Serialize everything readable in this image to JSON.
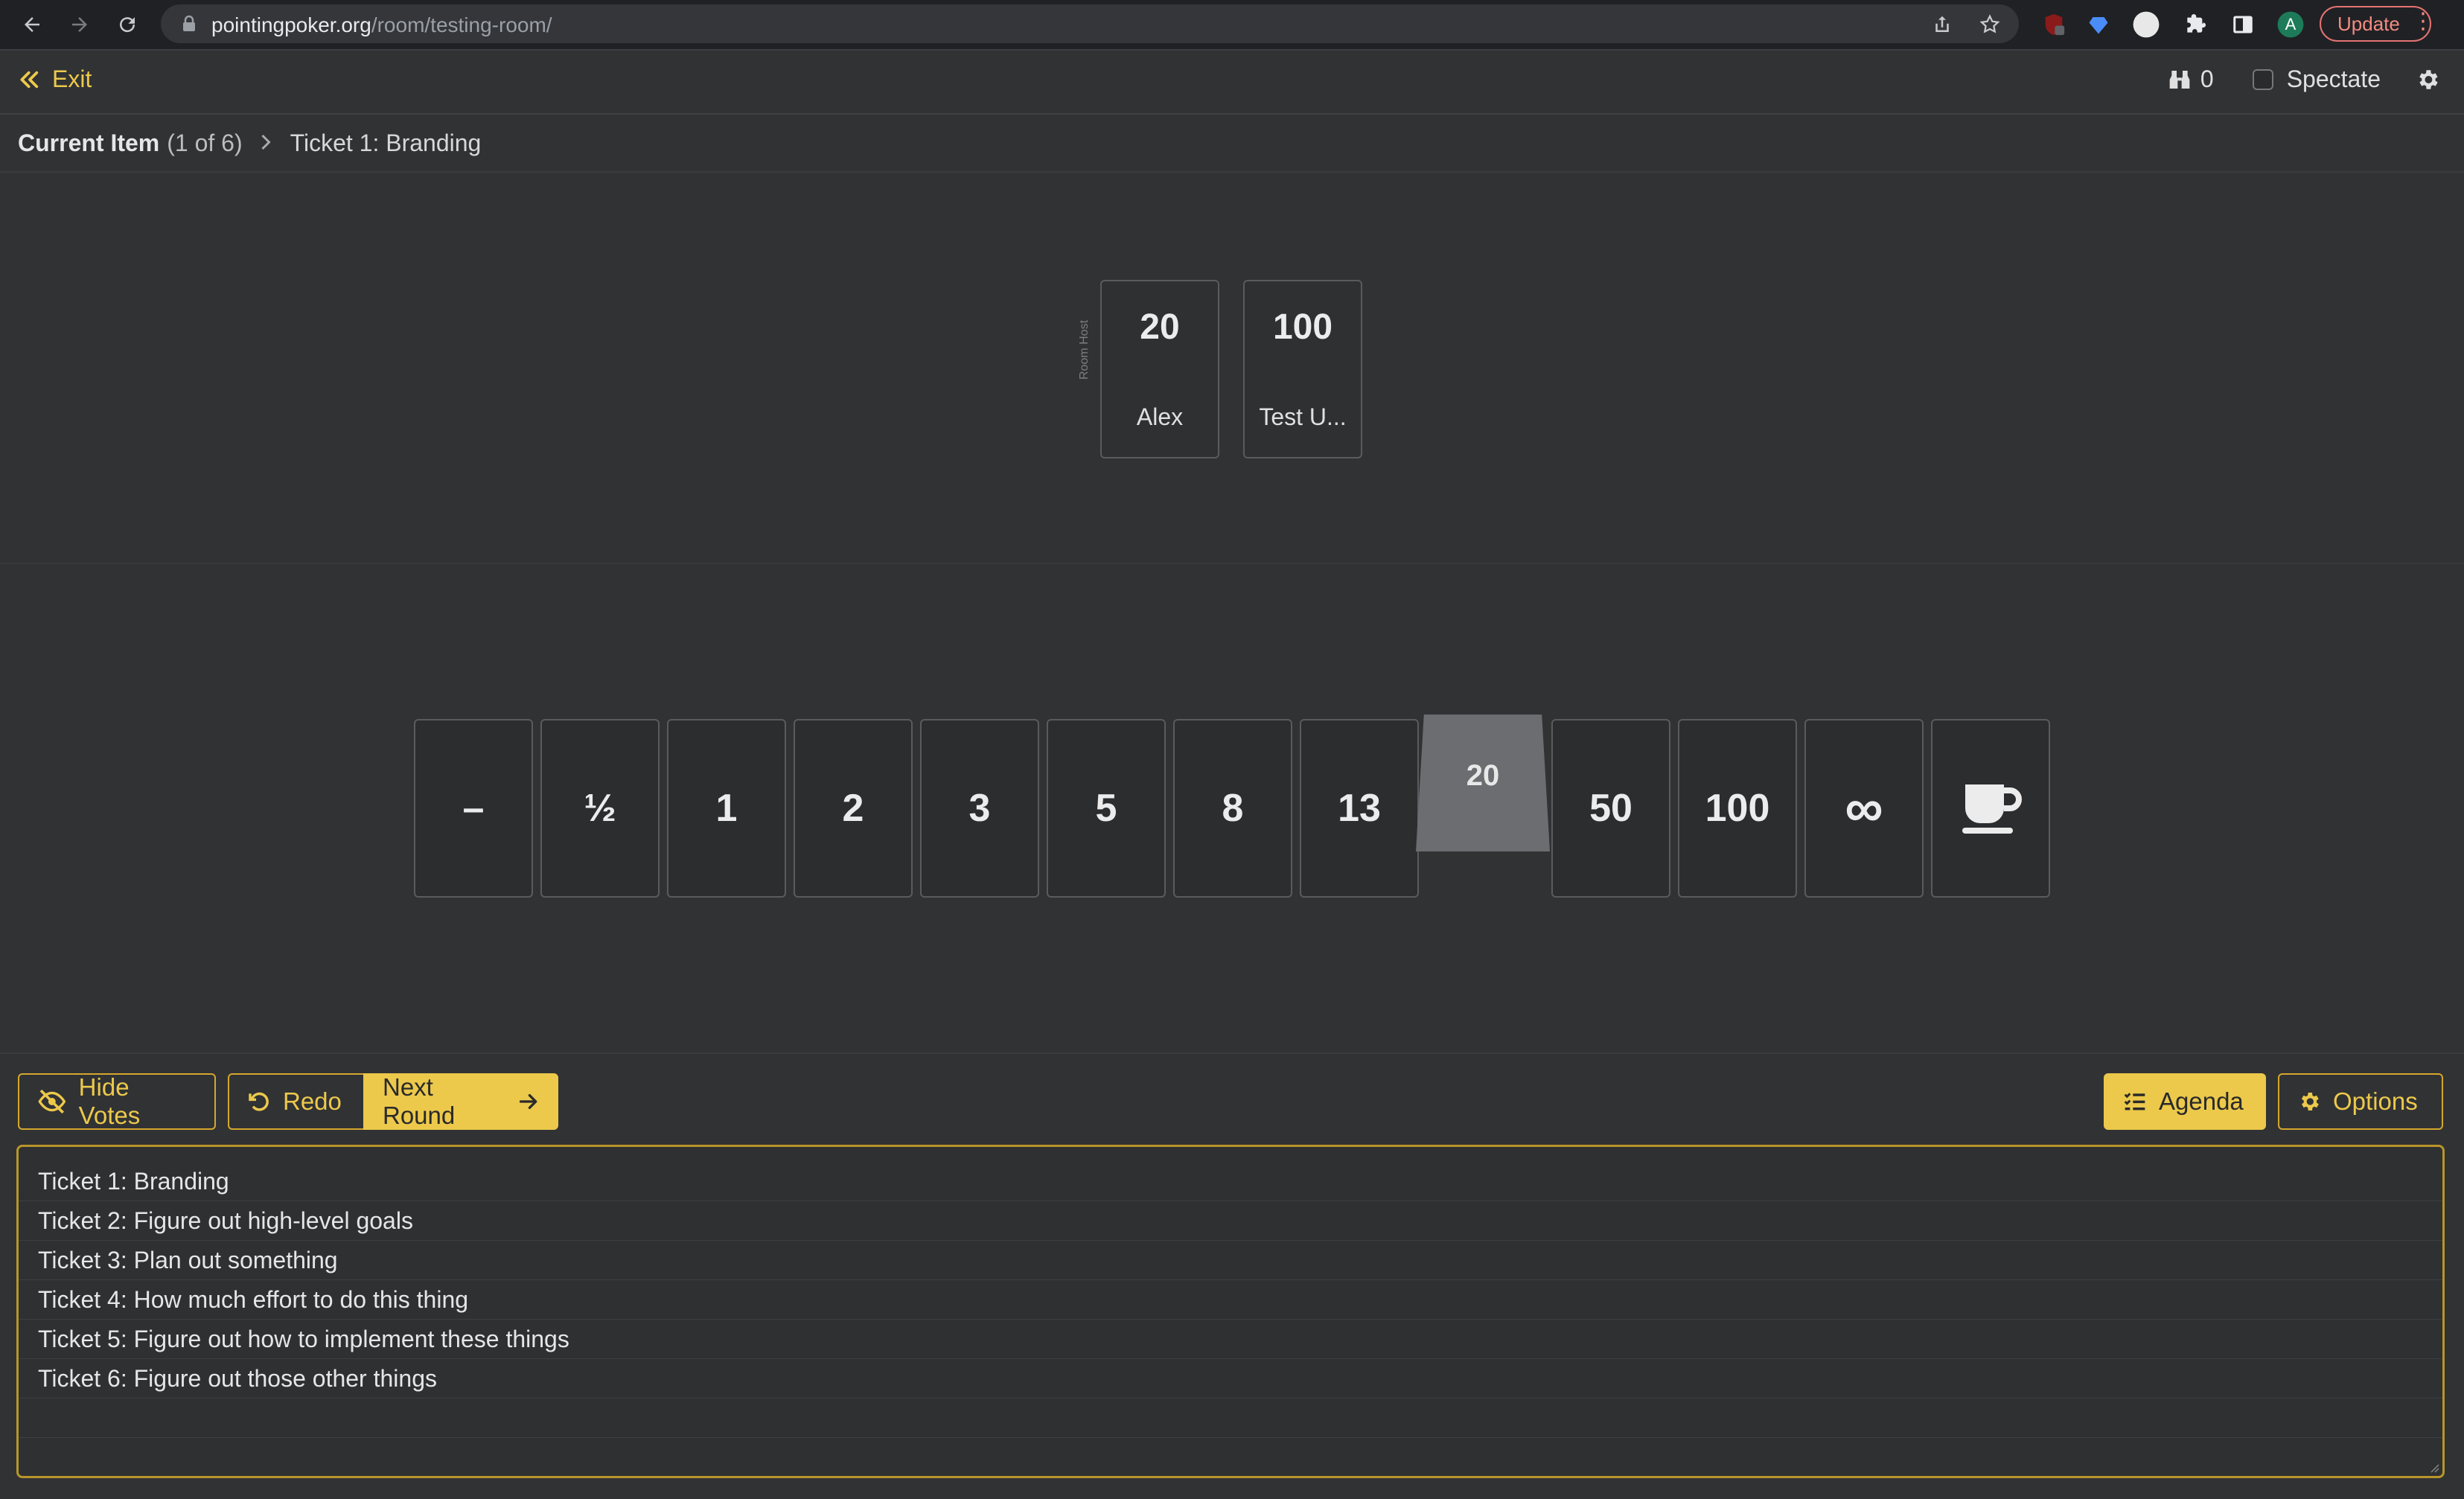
{
  "browser": {
    "url_host": "pointingpoker.org",
    "url_path": "/room/testing-room/",
    "update_label": "Update",
    "profile_initial": "A"
  },
  "topbar": {
    "exit_label": "Exit",
    "spectator_count": "0",
    "spectate_label": "Spectate"
  },
  "breadcrumb": {
    "title": "Current Item",
    "count": "(1 of 6)",
    "item": "Ticket 1: Branding"
  },
  "votes": {
    "host_label": "Room Host",
    "cards": [
      {
        "value": "20",
        "name": "Alex"
      },
      {
        "value": "100",
        "name": "Test U..."
      }
    ]
  },
  "deck": {
    "cards": [
      "–",
      "½",
      "1",
      "2",
      "3",
      "5",
      "8",
      "13",
      "20",
      "50",
      "100",
      "∞",
      "coffee-icon"
    ],
    "selected_value": "20"
  },
  "controls": {
    "hide_votes": "Hide Votes",
    "redo": "Redo",
    "next_round": "Next Round",
    "agenda": "Agenda",
    "options": "Options"
  },
  "agenda": {
    "items": [
      "Ticket 1: Branding",
      "Ticket 2: Figure out high-level goals",
      "Ticket 3: Plan out something",
      "Ticket 4: How much effort to do this thing",
      "Ticket 5: Figure out how to implement these things",
      "Ticket 6: Figure out those other things"
    ]
  },
  "colors": {
    "accent": "#ecc94b",
    "background": "#313234"
  }
}
